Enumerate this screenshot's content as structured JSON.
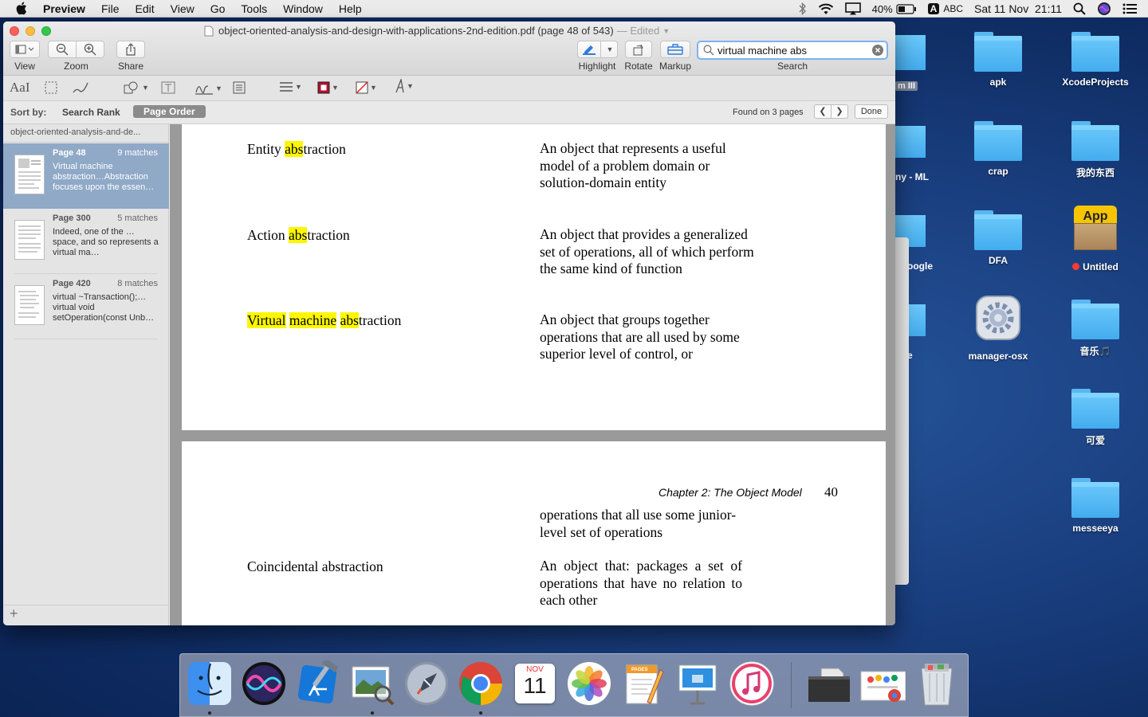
{
  "menubar": {
    "app_name": "Preview",
    "items": [
      "File",
      "Edit",
      "View",
      "Go",
      "Tools",
      "Window",
      "Help"
    ],
    "battery": "40%",
    "input_source": "ABC",
    "input_badge": "A",
    "datetime": "Sat 11 Nov  21:11"
  },
  "desktop": {
    "icons": [
      {
        "label": "apk"
      },
      {
        "label": "XcodeProjects"
      },
      {
        "label": "crap"
      },
      {
        "label": "我的东西"
      },
      {
        "label": "DFA"
      },
      {
        "label": "Untitled"
      },
      {
        "label": "manager-osx"
      },
      {
        "label": "音乐🎵"
      },
      {
        "label": "可爱"
      },
      {
        "label": "messeeya"
      }
    ],
    "partial_labels": [
      "m III",
      "ny - ML",
      "oogle",
      "e"
    ],
    "app_badge_text": "App",
    "untitled_tag_color": "#ff3b30"
  },
  "window": {
    "title": "object-oriented-analysis-and-design-with-applications-2nd-edition.pdf (page 48 of 543)",
    "edited": "— Edited",
    "toolbar": {
      "view_label": "View",
      "zoom_label": "Zoom",
      "share_label": "Share",
      "highlight_label": "Highlight",
      "rotate_label": "Rotate",
      "markup_label": "Markup",
      "search_label": "Search",
      "search_value": "virtual machine abs"
    },
    "markup": {
      "text_style": "AaI"
    },
    "sortbar": {
      "sort_by": "Sort by:",
      "search_rank": "Search Rank",
      "page_order": "Page Order",
      "found": "Found on 3 pages",
      "done": "Done"
    },
    "sidebar": {
      "doc_name": "object-oriented-analysis-and-de...",
      "results": [
        {
          "page": "Page 48",
          "matches": "9 matches",
          "snippet": "Virtual machine abstraction…Abstraction focuses upon the essen…",
          "selected": true
        },
        {
          "page": "Page 300",
          "matches": "5 matches",
          "snippet": "Indeed, one of the … space, and so represents a virtual ma…",
          "selected": false
        },
        {
          "page": "Page 420",
          "matches": "8 matches",
          "snippet": "virtual ~Transaction();… virtual void setOperation(const Unb…",
          "selected": false
        }
      ],
      "add_label": "+"
    },
    "document": {
      "page1": {
        "rows": [
          {
            "term_pre": "Entity ",
            "term_hl": "abs",
            "term_post": "traction",
            "definition": "An object that represents a useful model of a problem domain or solution-domain entity"
          },
          {
            "term_pre": "Action ",
            "term_hl": "abs",
            "term_post": "traction",
            "definition": "An object that provides a generalized set of operations, all of which perform the same kind of function"
          },
          {
            "term_hl1": "Virtual",
            "term_hl2": "machine",
            "term_hl3": "abs",
            "term_post": "traction",
            "definition": "An object that groups together operations that are all used by some superior level of control, or"
          }
        ]
      },
      "page2": {
        "header": "Chapter 2: The Object Model",
        "page_number": "40",
        "continued": "operations that all use some junior-level set of operations",
        "term": "Coincidental abstraction",
        "definition": "An object that: packages a set of operations that have no relation to each other"
      }
    }
  },
  "dock": {
    "apps": [
      "finder-icon",
      "siri-icon",
      "xcode-icon",
      "preview-icon",
      "launchpad-icon",
      "chrome-icon",
      "calendar-icon",
      "photos-icon",
      "pages-icon",
      "keynote-icon",
      "itunes-icon",
      "folder-stack-icon",
      "downloads-stack-icon",
      "trash-icon"
    ],
    "calendar_month": "NOV",
    "calendar_day": "11",
    "pages_badge": "PAGES"
  }
}
